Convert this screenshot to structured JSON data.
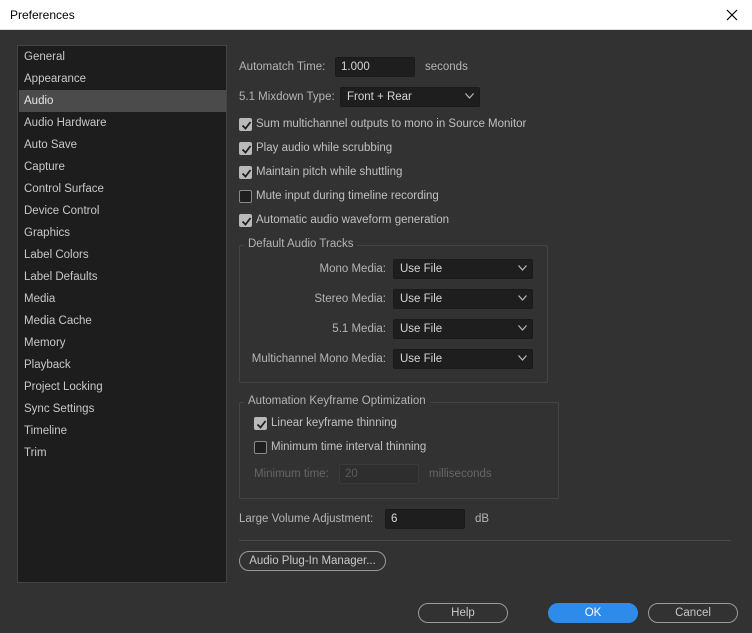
{
  "window": {
    "title": "Preferences",
    "close_icon": "close-icon"
  },
  "sidebar": {
    "items": [
      {
        "label": "General"
      },
      {
        "label": "Appearance"
      },
      {
        "label": "Audio",
        "selected": true
      },
      {
        "label": "Audio Hardware"
      },
      {
        "label": "Auto Save"
      },
      {
        "label": "Capture"
      },
      {
        "label": "Control Surface"
      },
      {
        "label": "Device Control"
      },
      {
        "label": "Graphics"
      },
      {
        "label": "Label Colors"
      },
      {
        "label": "Label Defaults"
      },
      {
        "label": "Media"
      },
      {
        "label": "Media Cache"
      },
      {
        "label": "Memory"
      },
      {
        "label": "Playback"
      },
      {
        "label": "Project Locking"
      },
      {
        "label": "Sync Settings"
      },
      {
        "label": "Timeline"
      },
      {
        "label": "Trim"
      }
    ]
  },
  "audio": {
    "automatch": {
      "label": "Automatch Time:",
      "value": "1.000",
      "unit": "seconds"
    },
    "mixdown": {
      "label": "5.1 Mixdown Type:",
      "value": "Front + Rear"
    },
    "checkboxes": [
      {
        "label": "Sum multichannel outputs to mono in Source Monitor",
        "checked": true
      },
      {
        "label": "Play audio while scrubbing",
        "checked": true
      },
      {
        "label": "Maintain pitch while shuttling",
        "checked": true
      },
      {
        "label": "Mute input during timeline recording",
        "checked": false
      },
      {
        "label": "Automatic audio waveform generation",
        "checked": true
      }
    ],
    "default_tracks": {
      "title": "Default Audio Tracks",
      "rows": [
        {
          "label": "Mono Media:",
          "value": "Use File"
        },
        {
          "label": "Stereo Media:",
          "value": "Use File"
        },
        {
          "label": "5.1 Media:",
          "value": "Use File"
        },
        {
          "label": "Multichannel Mono Media:",
          "value": "Use File"
        }
      ]
    },
    "keyframe": {
      "title": "Automation Keyframe Optimization",
      "linear": {
        "label": "Linear keyframe thinning",
        "checked": true
      },
      "min_interval": {
        "label": "Minimum time interval thinning",
        "checked": false
      },
      "min_time": {
        "label": "Minimum time:",
        "value": "20",
        "unit": "milliseconds",
        "enabled": false
      }
    },
    "volume": {
      "label": "Large Volume Adjustment:",
      "value": "6",
      "unit": "dB"
    },
    "plugin_manager": "Audio Plug-In Manager..."
  },
  "footer": {
    "help": "Help",
    "ok": "OK",
    "cancel": "Cancel"
  },
  "colors": {
    "accent": "#2d8ceb",
    "background": "#323232",
    "sidebar": "#1d1d1d",
    "selected": "#4b4b4b"
  }
}
